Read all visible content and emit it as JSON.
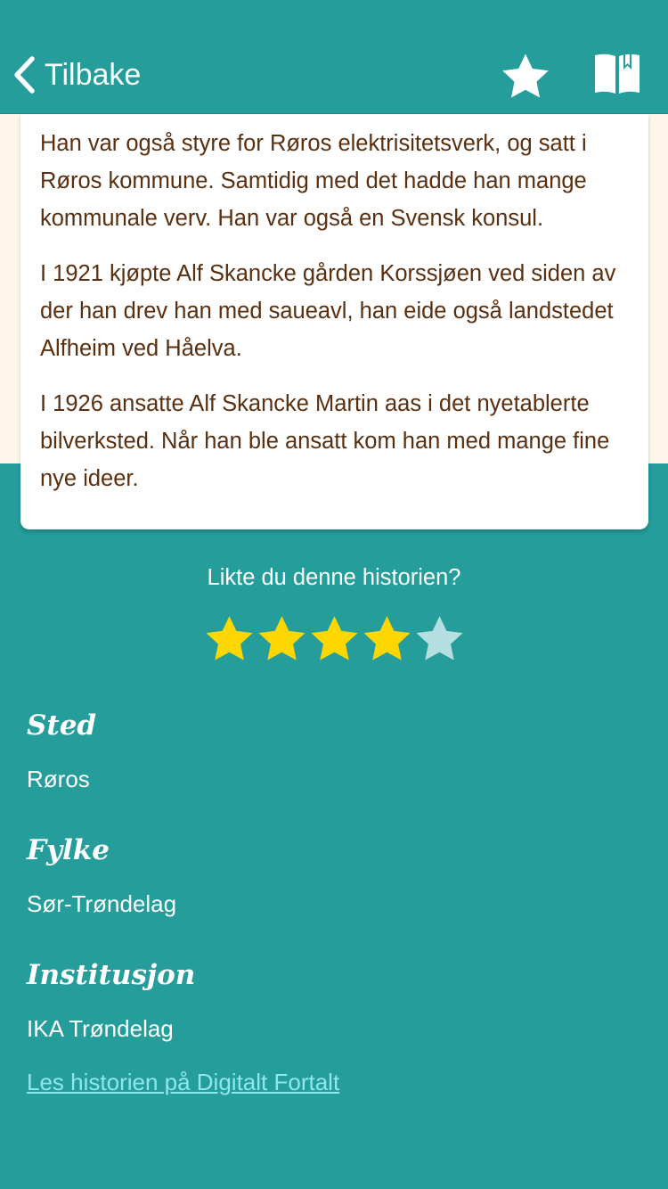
{
  "header": {
    "back_label": "Tilbake",
    "back_icon": "chevron-left-icon",
    "favorite_icon": "star-icon",
    "reading_list_icon": "book-bookmark-icon"
  },
  "story": {
    "paragraphs": [
      "Han var også styre for Røros elektrisitetsverk, og satt i Røros kommune. Samtidig med det hadde han mange kommunale verv. Han var også en Svensk konsul.",
      "I 1921 kjøpte Alf Skancke gården Korssjøen ved siden av der han drev han med saueavl, han eide også landstedet Alfheim ved Håelva.",
      "I 1926 ansatte Alf Skancke Martin aas i det nyetablerte bilverksted. Når han ble ansatt kom han med mange fine nye ideer."
    ]
  },
  "rating": {
    "question": "Likte du denne historien?",
    "value": 4,
    "max": 5
  },
  "meta": {
    "place_label": "Sted",
    "place_value": "Røros",
    "county_label": "Fylke",
    "county_value": "Sør-Trøndelag",
    "institution_label": "Institusjon",
    "institution_value": "IKA Trøndelag"
  },
  "link": {
    "label": "Les historien på Digitalt Fortalt"
  },
  "colors": {
    "background": "#249d9b",
    "cream": "#fdf6e9",
    "story_text": "#5a2f0f",
    "star_filled": "#ffd700",
    "star_empty": "#b5dfe0",
    "link": "#8fe6ee"
  }
}
